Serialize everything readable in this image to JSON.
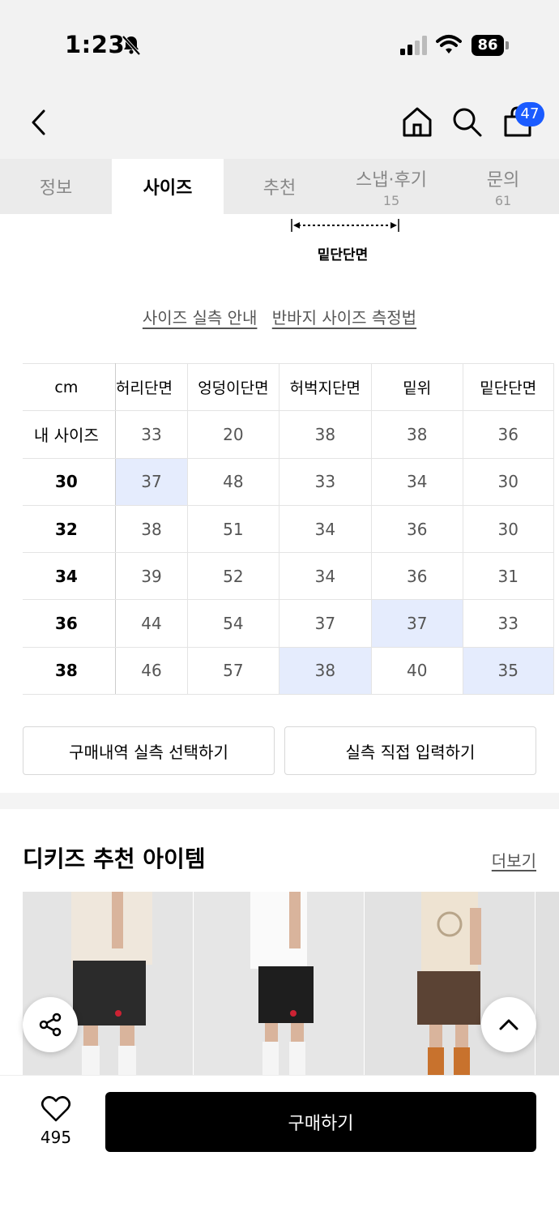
{
  "status_bar": {
    "time": "1:23",
    "battery": "86"
  },
  "nav": {
    "cart_count": "47"
  },
  "tabs": [
    {
      "label": "정보",
      "count": ""
    },
    {
      "label": "사이즈",
      "count": ""
    },
    {
      "label": "추천",
      "count": ""
    },
    {
      "label": "스냅·후기",
      "count": "15"
    },
    {
      "label": "문의",
      "count": "61"
    }
  ],
  "diagram": {
    "label": "밑단단면"
  },
  "guide_links": {
    "actual_size_guide": "사이즈 실측 안내",
    "shorts_measure": "반바지 사이즈 측정법"
  },
  "size_table": {
    "unit": "cm",
    "columns": [
      "허리단면",
      "엉덩이단면",
      "허벅지단면",
      "밑위",
      "밑단단면"
    ],
    "rows": [
      {
        "label": "내 사이즈",
        "values": [
          "33",
          "20",
          "38",
          "38",
          "36"
        ]
      },
      {
        "label": "30",
        "values": [
          "37",
          "48",
          "33",
          "34",
          "30"
        ]
      },
      {
        "label": "32",
        "values": [
          "38",
          "51",
          "34",
          "36",
          "30"
        ]
      },
      {
        "label": "34",
        "values": [
          "39",
          "52",
          "34",
          "36",
          "31"
        ]
      },
      {
        "label": "36",
        "values": [
          "44",
          "54",
          "37",
          "37",
          "33"
        ]
      },
      {
        "label": "38",
        "values": [
          "46",
          "57",
          "38",
          "40",
          "35"
        ]
      }
    ]
  },
  "buttons": {
    "select_purchase": "구매내역 실측 선택하기",
    "manual_input": "실측 직접 입력하기"
  },
  "recommend": {
    "title": "디키즈 추천 아이템",
    "more": "더보기"
  },
  "bottom": {
    "likes": "495",
    "buy_label": "구매하기"
  },
  "colors": {
    "accent_blue": "#1a5bff",
    "highlight": "#e5ecfd"
  }
}
